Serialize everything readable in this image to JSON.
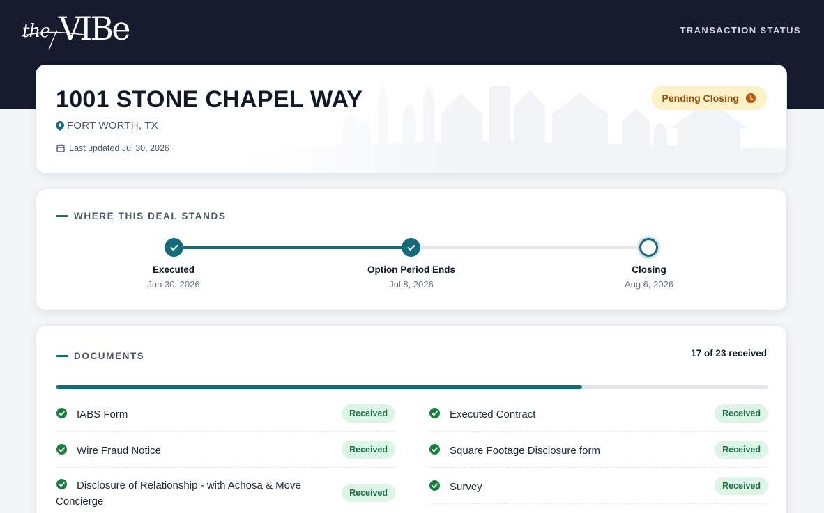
{
  "header": {
    "logo_alt": "the VIBE",
    "nav_link": "TRANSACTION STATUS"
  },
  "property": {
    "address": "1001 STONE CHAPEL WAY",
    "location": "FORT WORTH, TX",
    "last_updated": "Last updated Jul 30, 2026",
    "status_badge": "Pending Closing",
    "status_color": "#fdf1c7"
  },
  "timeline": {
    "title": "WHERE THIS DEAL STANDS",
    "steps": [
      {
        "label": "Executed",
        "date": "Jun 30, 2026",
        "done": true
      },
      {
        "label": "Option Period Ends",
        "date": "Jul 8, 2026",
        "done": true
      },
      {
        "label": "Closing",
        "date": "Aug 6, 2026",
        "done": false
      }
    ]
  },
  "documents": {
    "title": "DOCUMENTS",
    "count_label": "17 of 23 received",
    "received": 17,
    "total": 23,
    "status_label": "Received",
    "left": [
      {
        "name": "IABS Form",
        "status": "Received"
      },
      {
        "name": "Wire Fraud Notice",
        "status": "Received"
      },
      {
        "name": "Disclosure of Relationship - with Achosa & Move Concierge",
        "status": "Received"
      }
    ],
    "right": [
      {
        "name": "Executed Contract",
        "status": "Received"
      },
      {
        "name": "Square Footage Disclosure form",
        "status": "Received"
      },
      {
        "name": "Survey",
        "status": "Received"
      }
    ]
  },
  "colors": {
    "accent": "#136b7c",
    "header_bg": "#161c2d",
    "success": "#17803d"
  }
}
